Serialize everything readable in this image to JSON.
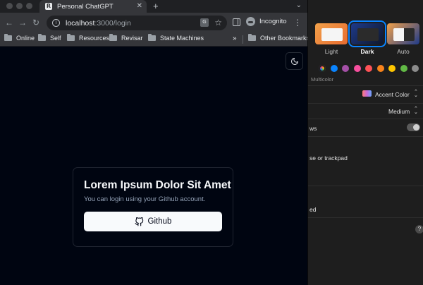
{
  "browser": {
    "tab": {
      "title": "Personal ChatGPT",
      "favicon": "R",
      "close": "✕"
    },
    "new_tab": "+",
    "tab_search": "⌄",
    "nav": {
      "back": "←",
      "forward": "→",
      "reload": "↻"
    },
    "omnibox": {
      "info": "i",
      "host": "localhost",
      "path": ":3000/login"
    },
    "translate": "G",
    "star": "☆",
    "incognito_label": "Incognito",
    "menu": "⋮",
    "bookmarks": [
      "Online",
      "Self",
      "Resources",
      "Revisar",
      "State Machines"
    ],
    "bookmarks_more": "»",
    "other_bookmarks": "Other Bookmarks"
  },
  "page": {
    "card": {
      "title": "Lorem Ipsum Dolor Sit Amet",
      "subtitle": "You can login using your Github account.",
      "button_label": "Github"
    }
  },
  "settings": {
    "themes": [
      {
        "label": "Light",
        "selected": false
      },
      {
        "label": "Dark",
        "selected": true
      },
      {
        "label": "Auto",
        "selected": false
      }
    ],
    "accent_swatches": [
      "#5c5cff",
      "#0a84ff",
      "#a550a7",
      "#f74f9e",
      "#ff5257",
      "#f7821b",
      "#ffc600",
      "#62ba46",
      "#8c8c8c"
    ],
    "multicolor_label": "Multicolor",
    "accent_color_value": "Accent Color",
    "size_value": "Medium",
    "row_windows": "ws",
    "row_trackpad": "se or trackpad",
    "row_ed": "ed",
    "help": "?",
    "colors": {
      "selected_outline": "#0a84ff",
      "page_bg": "#000511",
      "button_bg": "#f8fafc"
    }
  }
}
